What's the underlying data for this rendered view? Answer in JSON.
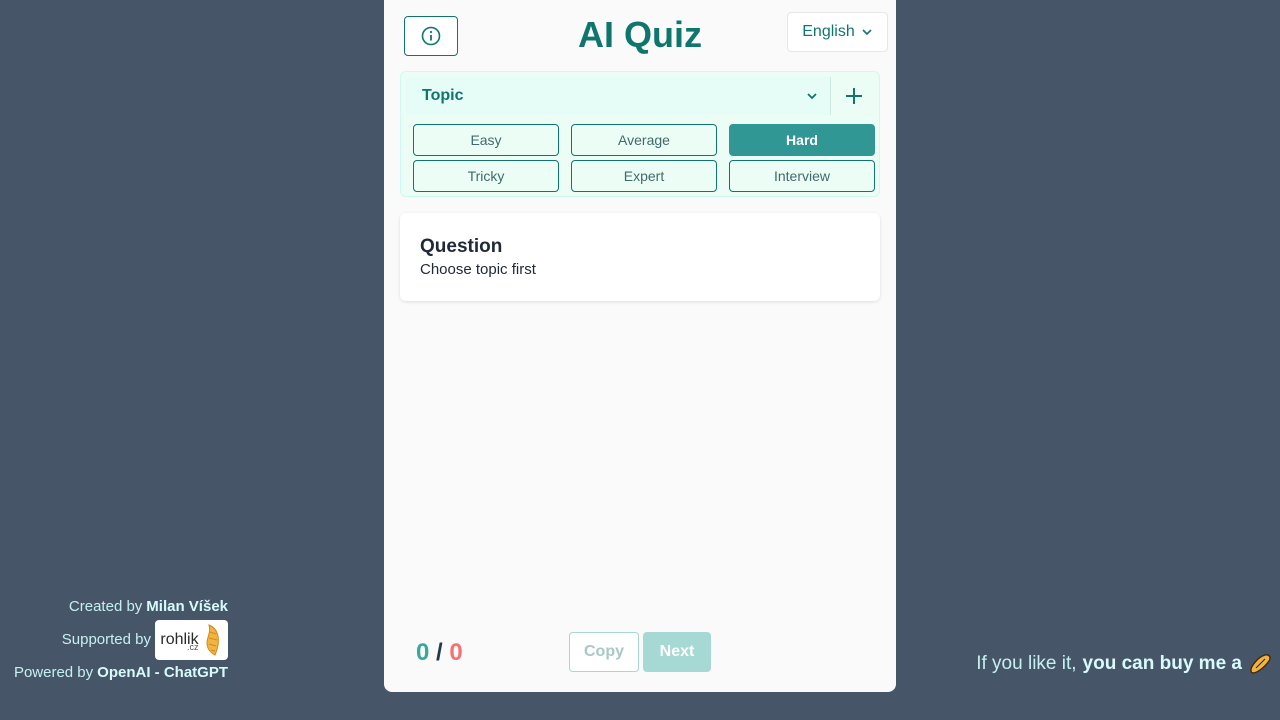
{
  "app": {
    "title": "AI Quiz"
  },
  "header": {
    "language": "English"
  },
  "topic": {
    "label": "Topic"
  },
  "difficulty": {
    "options": [
      "Easy",
      "Average",
      "Hard",
      "Tricky",
      "Expert",
      "Interview"
    ],
    "selected": "Hard"
  },
  "question": {
    "heading": "Question",
    "text": "Choose topic first"
  },
  "score": {
    "correct": "0",
    "separator": "/",
    "wrong": "0"
  },
  "actions": {
    "copy_label": "Copy",
    "next_label": "Next"
  },
  "credits": {
    "created_prefix": "Created by",
    "created_name": "Milan Víšek",
    "supported_prefix": "Supported by",
    "supporter_logo_text": "rohlik",
    "supporter_logo_sub": ".cz",
    "powered_prefix": "Powered by",
    "powered_name": "OpenAI - ChatGPT"
  },
  "buy_me": {
    "prefix": "If you like it,",
    "link": "you can buy me a"
  },
  "colors": {
    "accent": "#0f766e",
    "background": "#475569",
    "active": "#319795",
    "wrong": "#f87171"
  }
}
